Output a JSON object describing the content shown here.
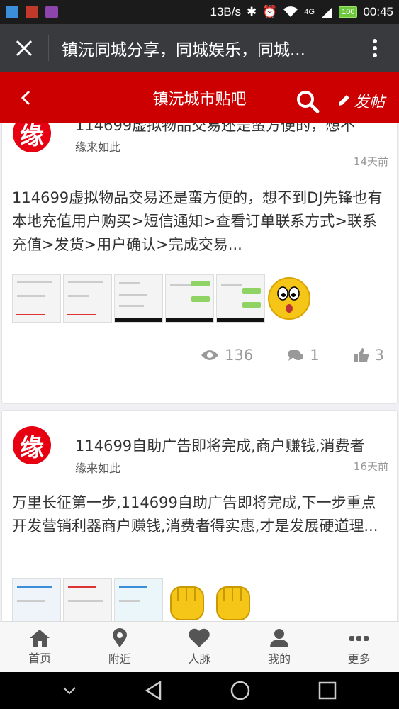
{
  "status_bar": {
    "speed": "13B/s",
    "network": "4G",
    "battery": "100",
    "time": "00:45"
  },
  "window": {
    "title": "镇沅同城分享，同城娱乐，同城..."
  },
  "forum": {
    "title": "镇沅城市贴吧",
    "post_label": "发帖"
  },
  "posts": [
    {
      "avatar_char": "缘",
      "title": "114699虚拟物品交易还是蛮方便的，想不",
      "author": "缘来如此",
      "time": "14天前",
      "body": "114699虚拟物品交易还是蛮方便的，想不到DJ先锋也有本地充值用户购买>短信通知>查看订单联系方式>联系充值>发货>用户确认>完成交易...",
      "views": "136",
      "comments": "1",
      "likes": "3"
    },
    {
      "avatar_char": "缘",
      "title": "114699自助广告即将完成,商户赚钱,消费者",
      "author": "缘来如此",
      "time": "16天前",
      "body": "万里长征第一步,114699自助广告即将完成,下一步重点开发营销利器商户赚钱,消费者得实惠,才是发展硬道理..."
    }
  ],
  "tabs": [
    {
      "label": "首页",
      "icon": "home-icon"
    },
    {
      "label": "附近",
      "icon": "location-pin-icon"
    },
    {
      "label": "人脉",
      "icon": "heart-icon"
    },
    {
      "label": "我的",
      "icon": "user-icon"
    },
    {
      "label": "更多",
      "icon": "more-dots-icon"
    }
  ],
  "colors": {
    "accent": "#cc0000",
    "title_bar": "#393a3e"
  }
}
